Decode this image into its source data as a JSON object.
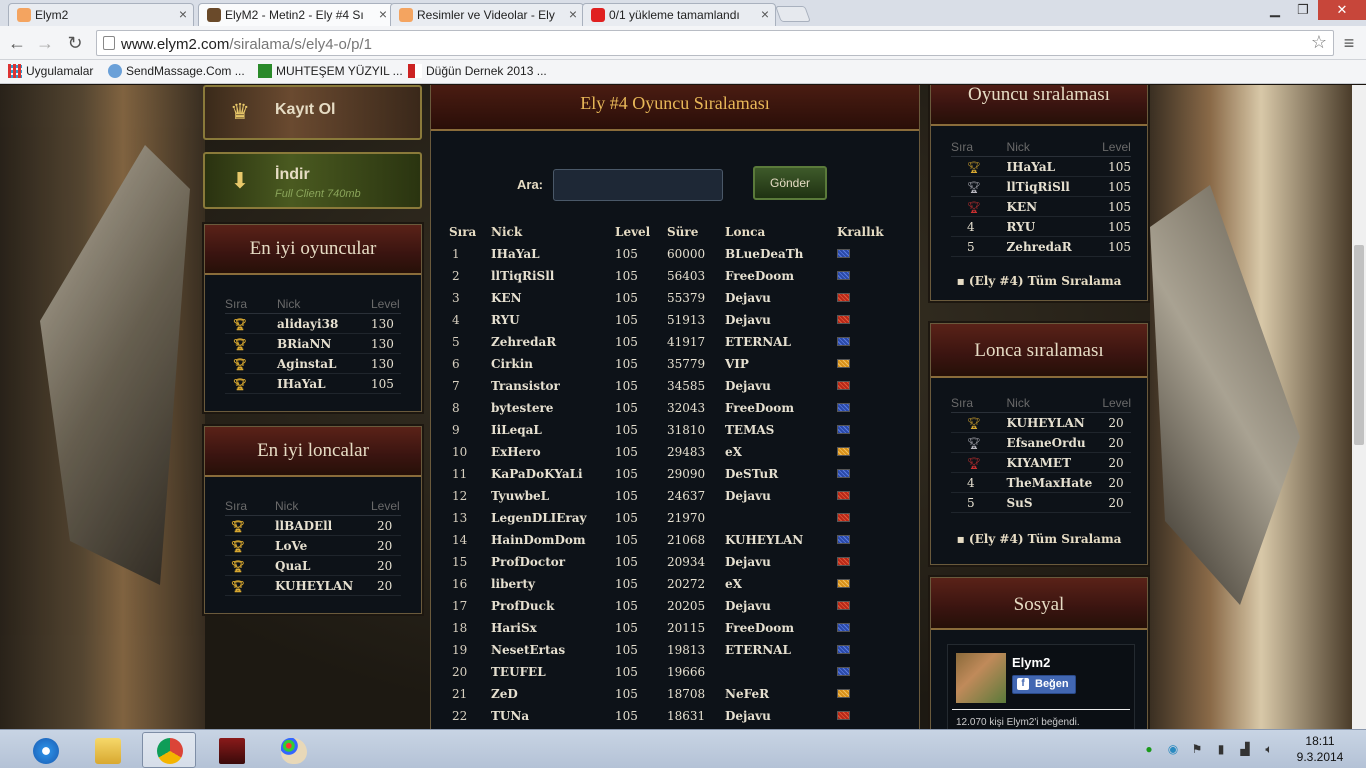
{
  "browser": {
    "tabs": [
      {
        "title": "Elym2",
        "fav_color": "#f4a460"
      },
      {
        "title": "ElyM2 - Metin2 - Ely #4 Sı",
        "fav_color": "#6a4a2a"
      },
      {
        "title": "Resimler ve Videolar - Ely",
        "fav_color": "#f4a460"
      },
      {
        "title": "0/1 yükleme tamamlandı",
        "fav_color": "#e02020"
      }
    ],
    "url_host": "www.elym2.com",
    "url_path": "/siralama/s/ely4-o/p/1",
    "bookmarks": [
      {
        "label": "Uygulamalar",
        "icon": "apps-grid-icon"
      },
      {
        "label": "SendMassage.Com ...",
        "icon": "globe-icon"
      },
      {
        "label": "MUHTEŞEM YÜZYIL ...",
        "icon": "film-icon"
      },
      {
        "label": "Düğün Dernek 2013 ...",
        "icon": "popcorn-icon"
      }
    ]
  },
  "sidebar_left": {
    "register": {
      "label": "Kayıt Ol",
      "icon": "crown-icon"
    },
    "download": {
      "label": "İndir",
      "sub": "Full Client 740mb",
      "icon": "download-icon"
    },
    "top_players": {
      "title": "En iyi oyuncular",
      "headers": [
        "Sıra",
        "Nick",
        "Level"
      ],
      "rows": [
        {
          "nick": "alidayi38",
          "level": "130"
        },
        {
          "nick": "BRiaNN",
          "level": "130"
        },
        {
          "nick": "AginstaL",
          "level": "130"
        },
        {
          "nick": "IHaYaL",
          "level": "105"
        }
      ]
    },
    "top_guilds": {
      "title": "En iyi loncalar",
      "headers": [
        "Sıra",
        "Nick",
        "Level"
      ],
      "rows": [
        {
          "nick": "llBADEll",
          "level": "20"
        },
        {
          "nick": "LoVe",
          "level": "20"
        },
        {
          "nick": "QuaL",
          "level": "20"
        },
        {
          "nick": "KUHEYLAN",
          "level": "20"
        }
      ]
    }
  },
  "main": {
    "title": "Ely #4 Oyuncu Sıralaması",
    "search_label": "Ara:",
    "search_value": "",
    "submit_label": "Gönder",
    "headers": [
      "Sıra",
      "Nick",
      "Level",
      "Süre",
      "Lonca",
      "Krallık"
    ],
    "rows": [
      {
        "rank": "1",
        "nick": "IHaYaL",
        "level": "105",
        "time": "60000",
        "guild": "BLueDeaTh",
        "kingdom": "blue"
      },
      {
        "rank": "2",
        "nick": "llTiqRiSll",
        "level": "105",
        "time": "56403",
        "guild": "FreeDoom",
        "kingdom": "blue"
      },
      {
        "rank": "3",
        "nick": "KEN",
        "level": "105",
        "time": "55379",
        "guild": "Dejavu",
        "kingdom": "red"
      },
      {
        "rank": "4",
        "nick": "RYU",
        "level": "105",
        "time": "51913",
        "guild": "Dejavu",
        "kingdom": "red"
      },
      {
        "rank": "5",
        "nick": "ZehredaR",
        "level": "105",
        "time": "41917",
        "guild": "ETERNAL",
        "kingdom": "blue"
      },
      {
        "rank": "6",
        "nick": "Cirkin",
        "level": "105",
        "time": "35779",
        "guild": "VIP",
        "kingdom": "yellow"
      },
      {
        "rank": "7",
        "nick": "Transistor",
        "level": "105",
        "time": "34585",
        "guild": "Dejavu",
        "kingdom": "red"
      },
      {
        "rank": "8",
        "nick": "bytestere",
        "level": "105",
        "time": "32043",
        "guild": "FreeDoom",
        "kingdom": "blue"
      },
      {
        "rank": "9",
        "nick": "IiLeqaL",
        "level": "105",
        "time": "31810",
        "guild": "TEMAS",
        "kingdom": "blue"
      },
      {
        "rank": "10",
        "nick": "ExHero",
        "level": "105",
        "time": "29483",
        "guild": "eX",
        "kingdom": "yellow"
      },
      {
        "rank": "11",
        "nick": "KaPaDoKYaLi",
        "level": "105",
        "time": "29090",
        "guild": "DeSTuR",
        "kingdom": "blue"
      },
      {
        "rank": "12",
        "nick": "TyuwbeL",
        "level": "105",
        "time": "24637",
        "guild": "Dejavu",
        "kingdom": "red"
      },
      {
        "rank": "13",
        "nick": "LegenDLIEray",
        "level": "105",
        "time": "21970",
        "guild": "",
        "kingdom": "red"
      },
      {
        "rank": "14",
        "nick": "HainDomDom",
        "level": "105",
        "time": "21068",
        "guild": "KUHEYLAN",
        "kingdom": "blue"
      },
      {
        "rank": "15",
        "nick": "ProfDoctor",
        "level": "105",
        "time": "20934",
        "guild": "Dejavu",
        "kingdom": "red"
      },
      {
        "rank": "16",
        "nick": "liberty",
        "level": "105",
        "time": "20272",
        "guild": "eX",
        "kingdom": "yellow"
      },
      {
        "rank": "17",
        "nick": "ProfDuck",
        "level": "105",
        "time": "20205",
        "guild": "Dejavu",
        "kingdom": "red"
      },
      {
        "rank": "18",
        "nick": "HariSx",
        "level": "105",
        "time": "20115",
        "guild": "FreeDoom",
        "kingdom": "blue"
      },
      {
        "rank": "19",
        "nick": "NesetErtas",
        "level": "105",
        "time": "19813",
        "guild": "ETERNAL",
        "kingdom": "blue"
      },
      {
        "rank": "20",
        "nick": "TEUFEL",
        "level": "105",
        "time": "19666",
        "guild": "",
        "kingdom": "blue"
      },
      {
        "rank": "21",
        "nick": "ZeD",
        "level": "105",
        "time": "18708",
        "guild": "NeFeR",
        "kingdom": "yellow"
      },
      {
        "rank": "22",
        "nick": "TUNa",
        "level": "105",
        "time": "18631",
        "guild": "Dejavu",
        "kingdom": "red"
      }
    ]
  },
  "sidebar_right": {
    "player_rank": {
      "title": "Oyuncu sıralaması",
      "headers": [
        "Sıra",
        "Nick",
        "Level"
      ],
      "rows": [
        {
          "rank": "",
          "nick": "IHaYaL",
          "level": "105",
          "medal": "gold"
        },
        {
          "rank": "",
          "nick": "llTiqRiSll",
          "level": "105",
          "medal": "silver"
        },
        {
          "rank": "",
          "nick": "KEN",
          "level": "105",
          "medal": "red"
        },
        {
          "rank": "4",
          "nick": "RYU",
          "level": "105",
          "medal": ""
        },
        {
          "rank": "5",
          "nick": "ZehredaR",
          "level": "105",
          "medal": ""
        }
      ],
      "link": "▪ (Ely #4) Tüm Sıralama"
    },
    "guild_rank": {
      "title": "Lonca sıralaması",
      "headers": [
        "Sıra",
        "Nick",
        "Level"
      ],
      "rows": [
        {
          "rank": "",
          "nick": "KUHEYLAN",
          "level": "20",
          "medal": "gold"
        },
        {
          "rank": "",
          "nick": "EfsaneOrdu",
          "level": "20",
          "medal": "silver"
        },
        {
          "rank": "",
          "nick": "KIYAMET",
          "level": "20",
          "medal": "red"
        },
        {
          "rank": "4",
          "nick": "TheMaxHate",
          "level": "20",
          "medal": ""
        },
        {
          "rank": "5",
          "nick": "SuS",
          "level": "20",
          "medal": ""
        }
      ],
      "link": "▪ (Ely #4) Tüm Sıralama"
    },
    "social": {
      "title": "Sosyal",
      "fb_name": "Elym2",
      "fb_like": "Beğen",
      "fb_count": "12.070 kişi Elym2'i beğendi."
    }
  },
  "taskbar": {
    "time": "18:11",
    "date": "9.3.2014"
  },
  "colors": {
    "kingdom_blue": "#2a4aa8",
    "kingdom_red": "#b82818",
    "kingdom_yellow": "#d89018"
  }
}
